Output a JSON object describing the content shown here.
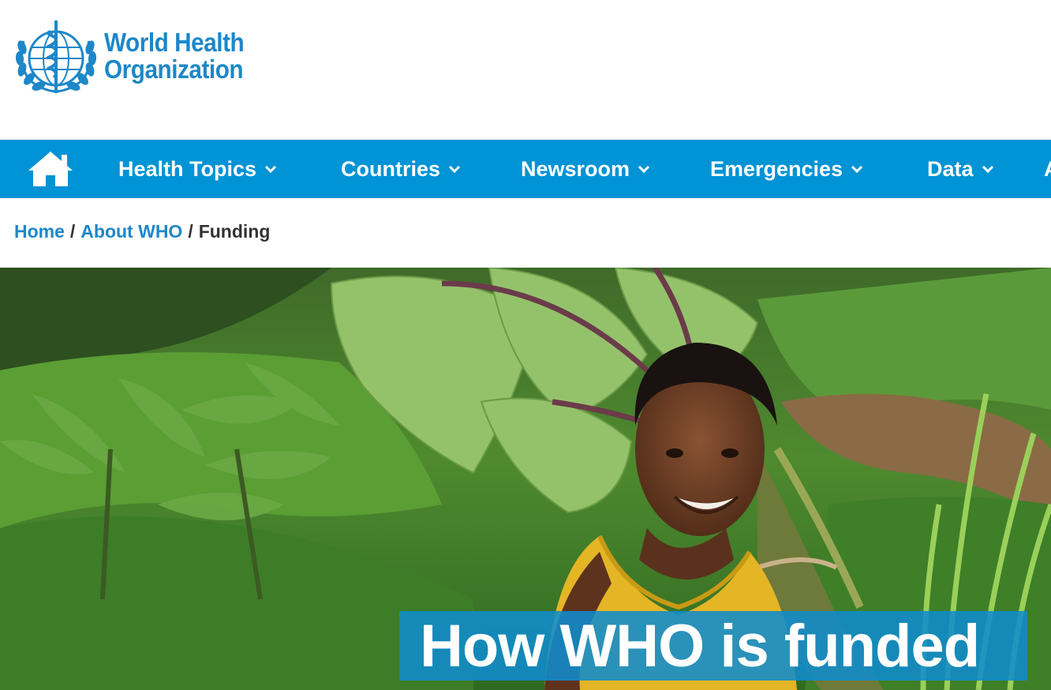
{
  "brand": {
    "line1": "World Health",
    "line2": "Organization",
    "logo_icon": "who-emblem-icon",
    "color": "#1d87c8"
  },
  "nav": {
    "background": "#0093d5",
    "home_icon": "home-icon",
    "items": [
      {
        "label": "Health Topics"
      },
      {
        "label": "Countries"
      },
      {
        "label": "Newsroom"
      },
      {
        "label": "Emergencies"
      },
      {
        "label": "Data"
      },
      {
        "label": "A"
      }
    ]
  },
  "breadcrumb": {
    "items": [
      {
        "label": "Home"
      },
      {
        "label": "About WHO"
      }
    ],
    "current": "Funding",
    "separator": "/"
  },
  "hero": {
    "title": "How WHO is funded",
    "image_subject": "hero-photo"
  }
}
